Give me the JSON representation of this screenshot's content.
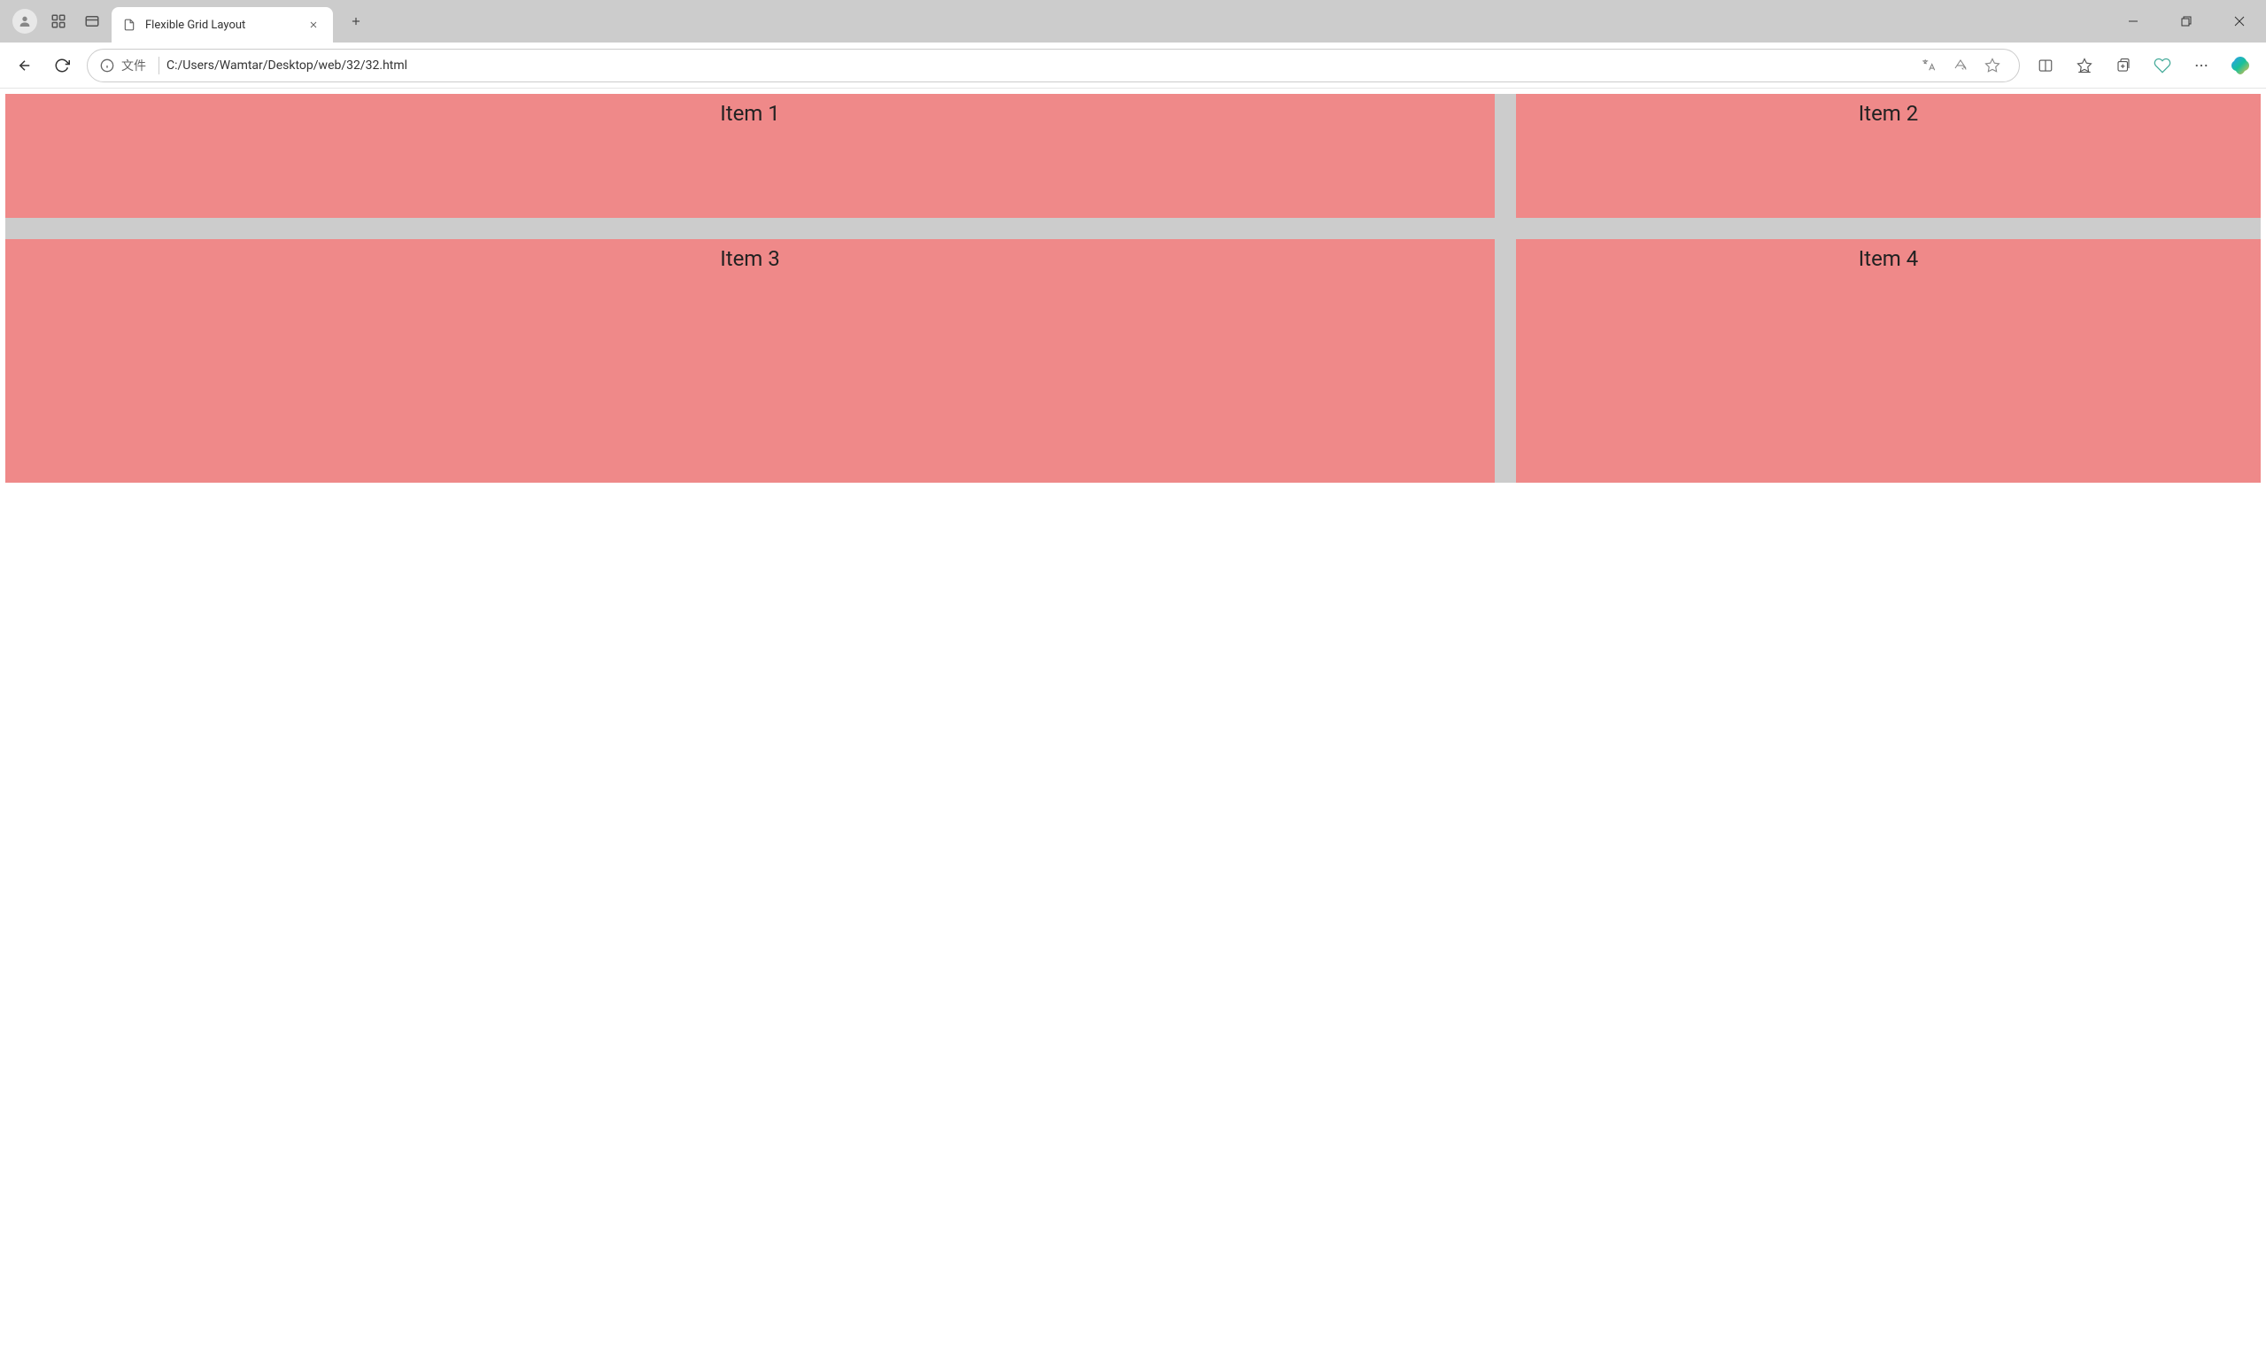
{
  "browser": {
    "tab_title": "Flexible Grid Layout",
    "url_prefix": "文件",
    "url": "C:/Users/Wamtar/Desktop/web/32/32.html"
  },
  "grid": {
    "items": [
      {
        "label": "Item 1"
      },
      {
        "label": "Item 2"
      },
      {
        "label": "Item 3"
      },
      {
        "label": "Item 4"
      }
    ]
  }
}
